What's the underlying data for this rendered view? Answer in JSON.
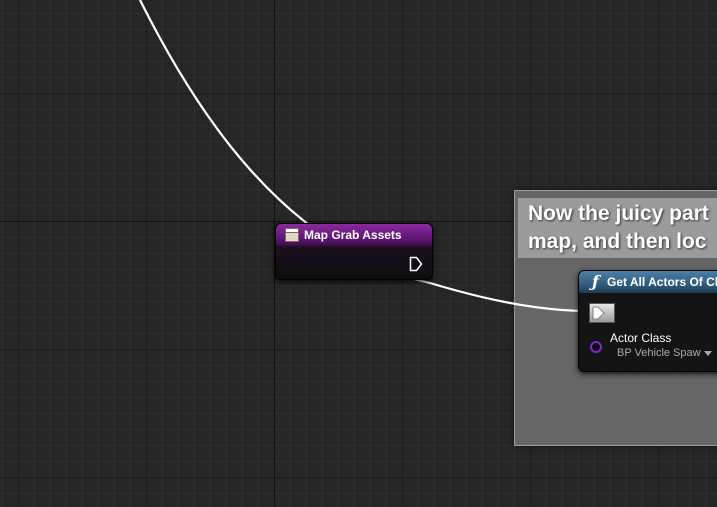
{
  "comment": {
    "text": "Now the juicy part\nmap, and then loc"
  },
  "nodes": {
    "map_grab": {
      "title": "Map Grab Assets",
      "header_color": "#7b1f8e"
    },
    "get_actors": {
      "title": "Get All Actors Of Class",
      "header_color": "#3f6e93",
      "pin_label": "Actor Class",
      "dropdown_value": "BP Vehicle Spaw"
    }
  },
  "colors": {
    "background": "#262626",
    "wire": "#ffffff",
    "object_pin": "#7a2cc4"
  },
  "icons": {
    "map_grab_header": "macro-box-icon",
    "get_actors_header": "function-icon",
    "exec_out": "exec-output-pin-icon",
    "exec_in": "exec-input-pin-icon",
    "object_pin": "object-pin-icon",
    "dropdown": "chevron-down-icon"
  }
}
